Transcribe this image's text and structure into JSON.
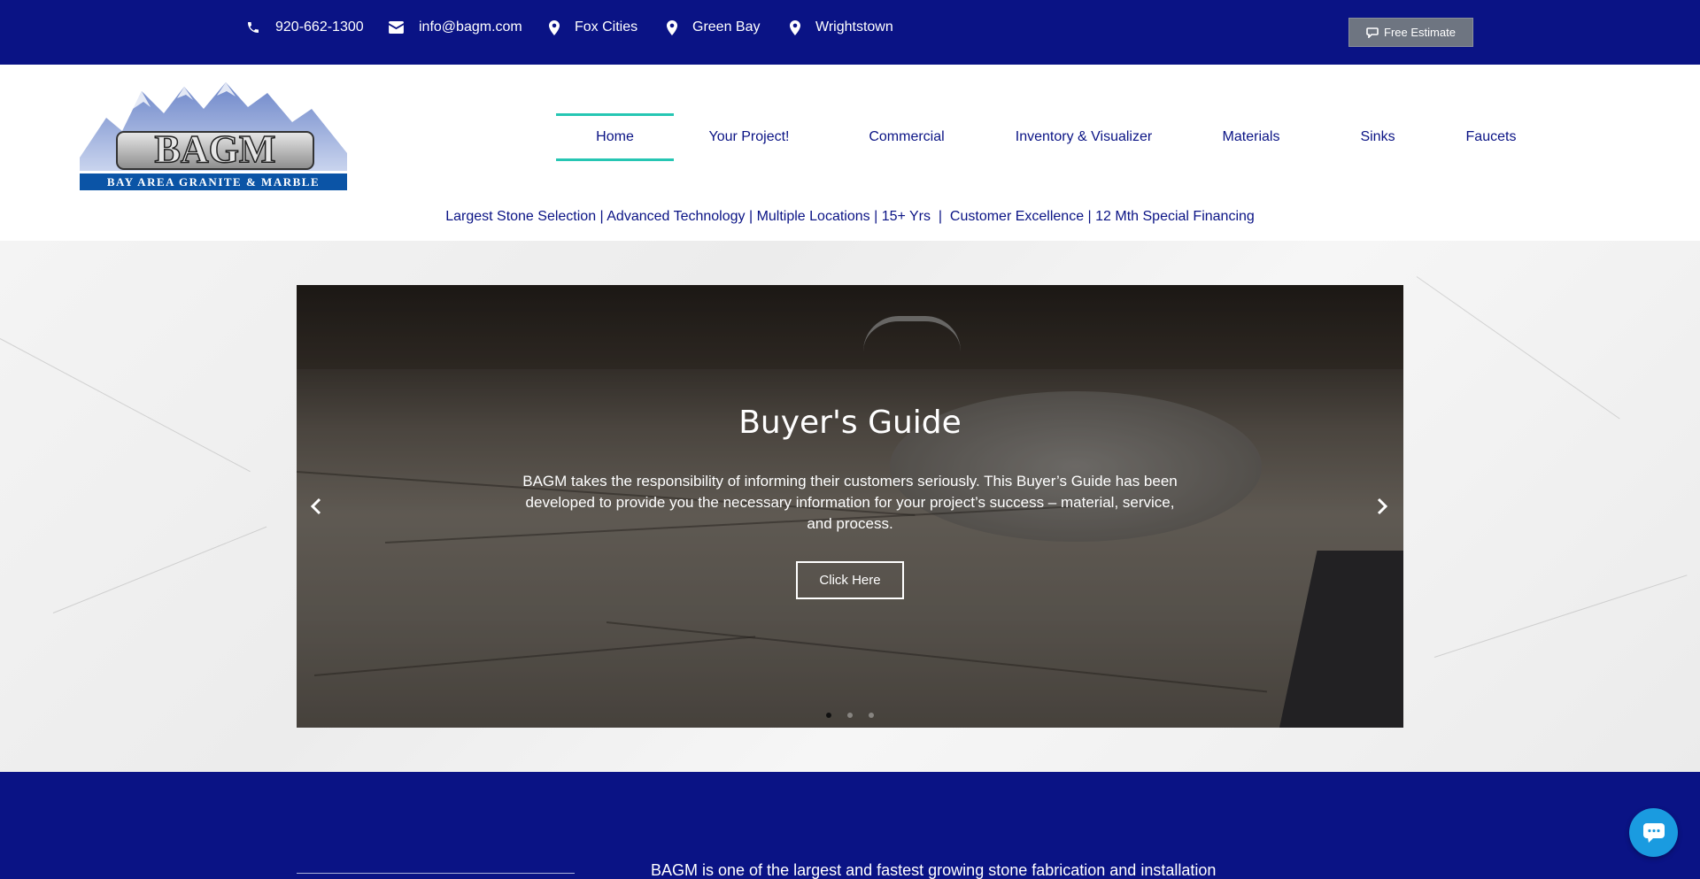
{
  "topbar": {
    "phone": "920-662-1300",
    "email": "info@bagm.com",
    "locations": [
      "Fox Cities",
      "Green Bay",
      "Wrightstown"
    ],
    "estimate_label": "Free Estimate"
  },
  "logo": {
    "name": "BAGM",
    "full_name": "BAY AREA GRANITE & MARBLE"
  },
  "nav": {
    "items": [
      {
        "label": "Home",
        "active": true
      },
      {
        "label": "Your Project!"
      },
      {
        "label": "Commercial"
      },
      {
        "label": "Inventory & Visualizer"
      },
      {
        "label": "Materials"
      },
      {
        "label": "Sinks"
      },
      {
        "label": "Faucets"
      }
    ]
  },
  "tagline": "Largest Stone Selection | Advanced Technology | Multiple Locations | 15+ Yrs  |  Customer Excellence | 12 Mth Special Financing",
  "hero": {
    "title": "Buyer's Guide",
    "text": "BAGM takes the responsibility of informing their customers seriously. This Buyer’s Guide has been developed to provide you the necessary information for your project’s success – material, service, and process.",
    "button_label": "Click Here",
    "slide_count": 3,
    "active_slide": 1
  },
  "about": {
    "text": "BAGM is one of the largest and fastest growing stone fabrication and installation"
  },
  "colors": {
    "brand_blue": "#0a1385",
    "accent_teal": "#26c6b3",
    "chat_blue": "#1a9be0"
  }
}
